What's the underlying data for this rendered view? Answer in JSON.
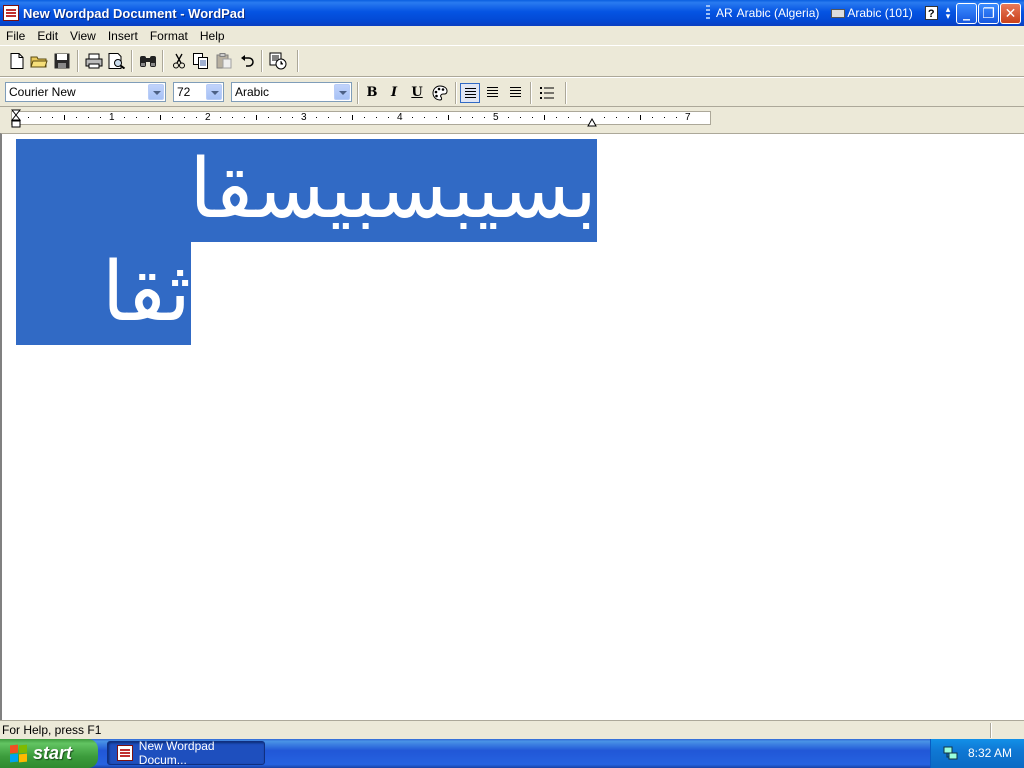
{
  "window": {
    "title": "New Wordpad Document - WordPad"
  },
  "langbar": {
    "language_code": "AR",
    "language": "Arabic (Algeria)",
    "keyboard": "Arabic (101)",
    "help": "?"
  },
  "window_controls": {
    "minimize": "_",
    "restore": "❐",
    "close": "✕"
  },
  "menu": [
    "File",
    "Edit",
    "View",
    "Insert",
    "Format",
    "Help"
  ],
  "toolbar": {
    "icons": [
      "new-document-icon",
      "open-folder-icon",
      "save-icon",
      "print-icon",
      "print-preview-icon",
      "find-icon",
      "cut-icon",
      "copy-icon",
      "paste-icon",
      "undo-icon",
      "insert-datetime-icon"
    ]
  },
  "format_bar": {
    "font": "Courier New",
    "size": "72",
    "script": "Arabic",
    "bold": "B",
    "italic": "I",
    "underline": "U",
    "alignment": "left"
  },
  "ruler": {
    "numbers": [
      "1",
      "2",
      "3",
      "4",
      "5",
      "7"
    ]
  },
  "document": {
    "lines": [
      "بسيبسبيسقا",
      "ثقا"
    ]
  },
  "status": {
    "help_text": "For Help, press F1"
  },
  "taskbar": {
    "start_label": "start",
    "task_label": "New Wordpad Docum...",
    "clock": "8:32 AM"
  },
  "colors": {
    "selection": "#316ac5",
    "titlebar": "#0554e3",
    "taskbar": "#2157d7",
    "start_button": "#3c9c3c"
  }
}
